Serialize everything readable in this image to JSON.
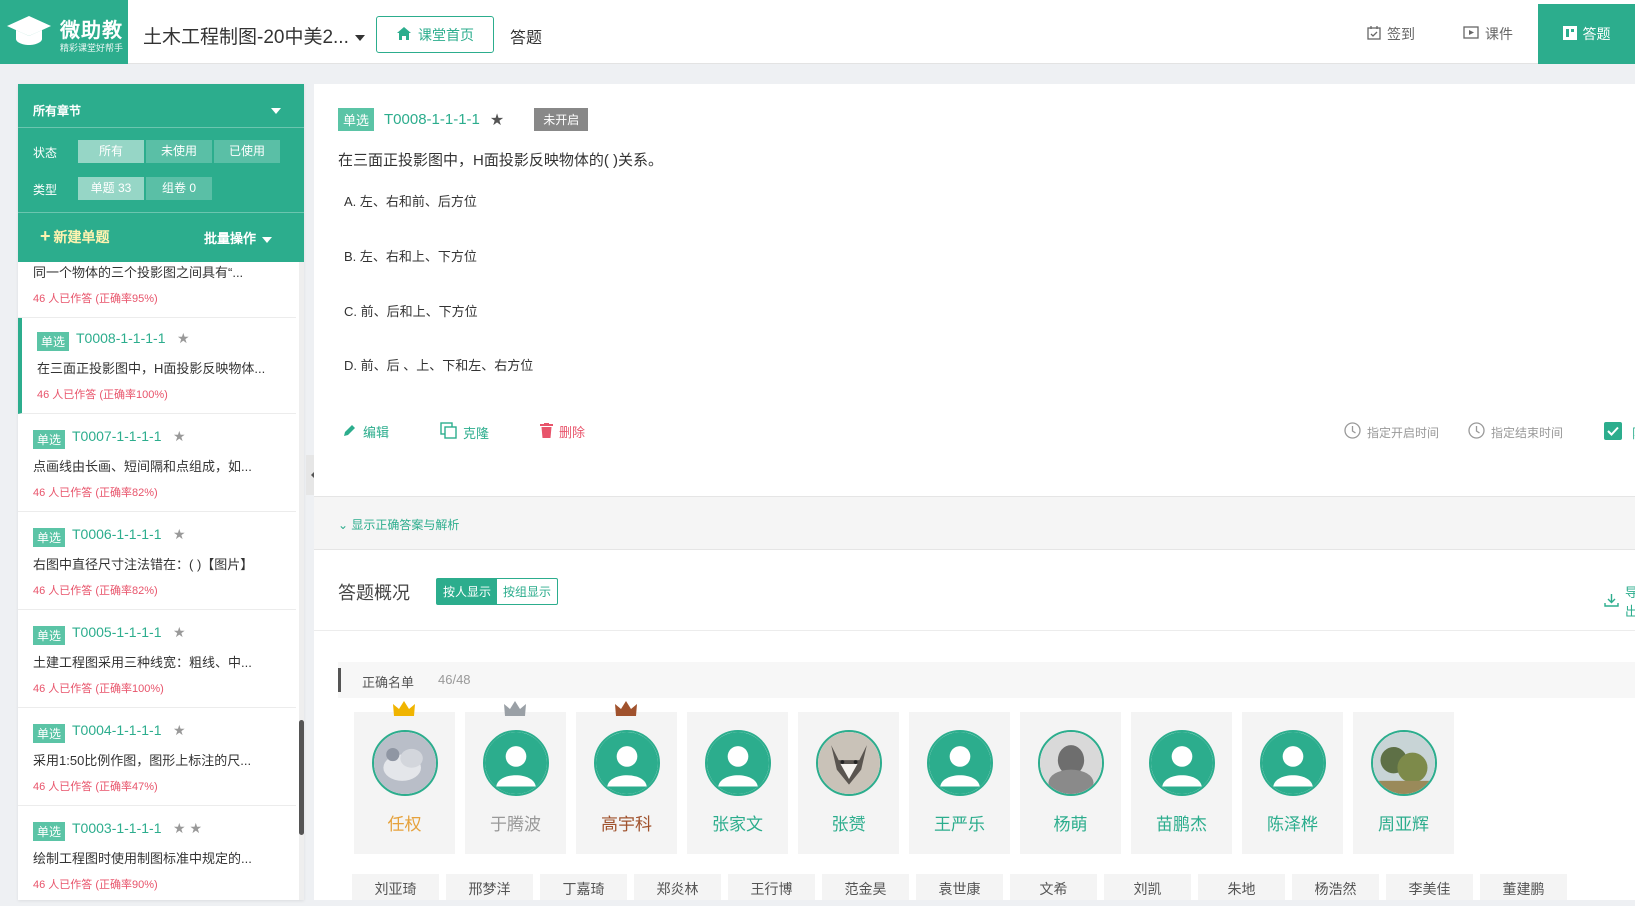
{
  "header": {
    "logo_name": "微助教",
    "logo_slogan": "精彩课堂好帮手",
    "course_title": "土木工程制图-20中美2...",
    "home_label": "课堂首页",
    "answer_nav": "答题",
    "checkin_label": "签到",
    "courseware_label": "课件",
    "active_label": "答题",
    "accent": "#2cad8d"
  },
  "filter": {
    "chapter": "所有章节",
    "status_label": "状态",
    "status_options": [
      "所有",
      "未使用",
      "已使用"
    ],
    "type_label": "类型",
    "type_options": [
      "单题 33",
      "组卷 0"
    ],
    "new_label": "新建单题",
    "batch_label": "批量操作"
  },
  "question_list": [
    {
      "tag": "",
      "code": "",
      "stars": "",
      "text": "同一个物体的三个投影图之间具有“...",
      "stat": "46 人已作答 (正确率95%)"
    },
    {
      "tag": "单选",
      "code": "T0008-1-1-1-1",
      "stars": "★",
      "text": "在三面正投影图中，H面投影反映物体...",
      "stat": "46 人已作答 (正确率100%)"
    },
    {
      "tag": "单选",
      "code": "T0007-1-1-1-1",
      "stars": "★",
      "text": "点画线由长画、短间隔和点组成，如...",
      "stat": "46 人已作答 (正确率82%)"
    },
    {
      "tag": "单选",
      "code": "T0006-1-1-1-1",
      "stars": "★",
      "text": "右图中直径尺寸注法错在：( )【图片】",
      "stat": "46 人已作答 (正确率82%)"
    },
    {
      "tag": "单选",
      "code": "T0005-1-1-1-1",
      "stars": "★",
      "text": "土建工程图采用三种线宽：粗线、中...",
      "stat": "46 人已作答 (正确率100%)"
    },
    {
      "tag": "单选",
      "code": "T0004-1-1-1-1",
      "stars": "★",
      "text": "采用1:50比例作图，图形上标注的尺...",
      "stat": "46 人已作答 (正确率47%)"
    },
    {
      "tag": "单选",
      "code": "T0003-1-1-1-1",
      "stars": "★ ★",
      "text": "绘制工程图时使用制图标准中规定的...",
      "stat": "46 人已作答 (正确率90%)"
    }
  ],
  "question": {
    "tag": "单选",
    "code": "T0008-1-1-1-1",
    "star": "★",
    "state": "未开启",
    "title": "在三面正投影图中，H面投影反映物体的(  )关系。",
    "options": [
      "A.  左、右和前、后方位",
      "B.  左、右和上、下方位",
      "C.  前、后和上、下方位",
      "D.  前、后 、上、下和左、右方位"
    ]
  },
  "actions": {
    "edit": "编辑",
    "clone": "克隆",
    "delete": "删除",
    "start_time": "指定开启时间",
    "end_time": "指定结束时间",
    "limit": "限"
  },
  "analysis": {
    "toggle_label": "显示正确答案与解析"
  },
  "overview": {
    "title": "答题概况",
    "by_person": "按人显示",
    "by_group": "按组显示",
    "export": "导出",
    "correct_label": "正确名单",
    "correct_count": "46/48"
  },
  "students": [
    {
      "name": "任权",
      "rank": "gold",
      "avatar": "photo-cat",
      "name_color": "#e6a23c"
    },
    {
      "name": "于腾波",
      "rank": "silver",
      "avatar": "default",
      "name_color": "#999999"
    },
    {
      "name": "高宇科",
      "rank": "bronze",
      "avatar": "default",
      "name_color": "#a0522d"
    },
    {
      "name": "张家文",
      "rank": "",
      "avatar": "default",
      "name_color": "#2cad8d"
    },
    {
      "name": "张赟",
      "rank": "",
      "avatar": "photo-husky",
      "name_color": "#2cad8d"
    },
    {
      "name": "王严乐",
      "rank": "",
      "avatar": "default",
      "name_color": "#2cad8d"
    },
    {
      "name": "杨萌",
      "rank": "",
      "avatar": "photo-gray",
      "name_color": "#2cad8d"
    },
    {
      "name": "苗鹏杰",
      "rank": "",
      "avatar": "default",
      "name_color": "#2cad8d"
    },
    {
      "name": "陈泽桦",
      "rank": "",
      "avatar": "default",
      "name_color": "#2cad8d"
    },
    {
      "name": "周亚辉",
      "rank": "",
      "avatar": "photo-tree",
      "name_color": "#2cad8d"
    }
  ],
  "student_chips": [
    "刘亚琦",
    "邢梦洋",
    "丁嘉琦",
    "郑炎林",
    "王行博",
    "范金昊",
    "袁世康",
    "文希",
    "刘凯",
    "朱地",
    "杨浩然",
    "李美佳",
    "董建鹏"
  ]
}
